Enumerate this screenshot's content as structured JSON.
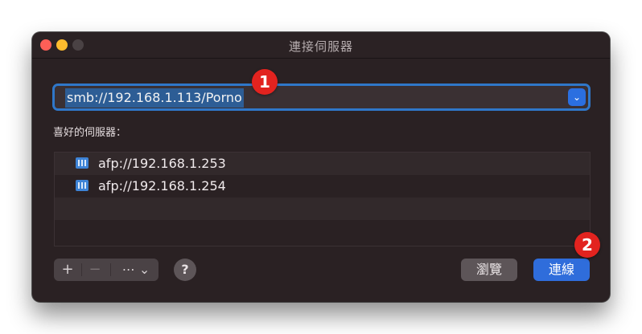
{
  "window": {
    "title": "連接伺服器"
  },
  "address_field": {
    "value": "smb://192.168.1.113/Porno",
    "dropdown_icon": "chevron-down-icon"
  },
  "favorites": {
    "label": "喜好的伺服器：",
    "items": [
      {
        "address": "afp://192.168.1.253",
        "icon": "server-icon"
      },
      {
        "address": "afp://192.168.1.254",
        "icon": "server-icon"
      }
    ]
  },
  "toolbar": {
    "add_label": "+",
    "remove_label": "−",
    "more_label": "⋯ ⌄",
    "help_label": "?"
  },
  "buttons": {
    "browse_label": "瀏覽",
    "connect_label": "連線"
  },
  "annotations": {
    "step1": "1",
    "step2": "2"
  },
  "colors": {
    "accent": "#2f6ddb",
    "badge": "#e2231f"
  }
}
